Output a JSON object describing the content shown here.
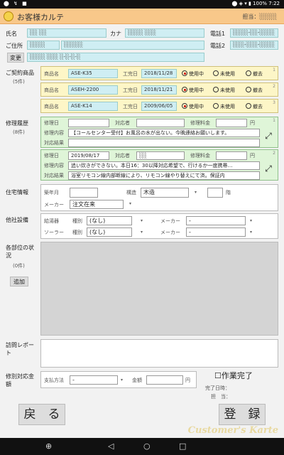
{
  "status": {
    "icons": "⬤ ↯ ■",
    "right": "⬤ ◈ ▾ ▮ 100% 7:22"
  },
  "header": {
    "title": "お客様カルテ",
    "staff": "担当：░░░░"
  },
  "customer": {
    "name_label": "氏名",
    "name_value": "░░ ░░",
    "kana_label": "カナ",
    "kana_value": "░░░░ ░░░",
    "tel1_label": "電話1",
    "tel1_value": "░░░░-░░-░░░░",
    "address_label": "ご住所",
    "address_value": "░░░░",
    "address_value2": "░░░░░",
    "tel2_label": "電話2",
    "tel2_value": "░░░-░░░-░░░░",
    "change_button": "変更",
    "address_line2": "░░░░ ░░░ ░-░-░-░"
  },
  "contracts": {
    "label": "ご契約商品",
    "count": "(5件)",
    "item_label": "商品名",
    "date_label": "工完日",
    "radio_labels": [
      "使用中",
      "未使用",
      "撤去"
    ],
    "items": [
      {
        "name": "ASE-K35",
        "date": "2018/11/28",
        "num": "1"
      },
      {
        "name": "ASEH-2200",
        "date": "2018/11/21",
        "num": "2"
      },
      {
        "name": "ASE-K14",
        "date": "2009/06/05",
        "num": "3"
      }
    ]
  },
  "repairs": {
    "label": "修理履歴",
    "count": "(8件)",
    "date_label": "修理日",
    "staff_label": "対応者",
    "fee_label": "修理料金",
    "yen": "円",
    "content_label": "修理内容",
    "result_label": "対応結果",
    "items": [
      {
        "date": "",
        "staff": "",
        "fee": "",
        "content": "【コールセンター受付】お風呂の水が出ない。今晩連絡お願いします。",
        "result": "",
        "num": "1"
      },
      {
        "date": "2019/08/17",
        "staff": "░░",
        "fee": "",
        "content": "追い炊きができない。本日16：30以降対応希望で、行けるか一度携帯…",
        "result": "浴室リモコン線内部断線により、リモコン線やり替えにて済。保証内",
        "num": "2"
      }
    ]
  },
  "housing": {
    "label": "住宅情報",
    "year_label": "築年月",
    "year_value": "",
    "structure_label": "構造",
    "structure_value": "木造",
    "floor_value": "",
    "floor_unit": "階",
    "maker_label": "メーカー",
    "maker_value": "注文在来"
  },
  "other_equipment": {
    "label": "他社設備",
    "rows": [
      {
        "name": "給湯器",
        "type_label": "種別",
        "type_value": "(なし)",
        "maker_label": "メーカー",
        "maker_value": "-"
      },
      {
        "name": "ソーラー",
        "type_label": "種別",
        "type_value": "(なし)",
        "maker_label": "メーカー",
        "maker_value": "-"
      }
    ]
  },
  "parts": {
    "label": "各部位の状況",
    "count": "(0件)",
    "add_button": "追加"
  },
  "visit": {
    "label": "訪問レポート"
  },
  "special_repair": {
    "label": "修別対応金額",
    "pay_label": "支払方法",
    "pay_value": "-",
    "amount_label": "金額",
    "amount_value": "",
    "yen": "円",
    "done_label": "作業完了",
    "done_time_label": "完了日時：",
    "done_staff_label": "担　当："
  },
  "footer": {
    "back_button": "戻　る",
    "register_button": "登　録",
    "brand": "Customer's Karte"
  },
  "navbar": {
    "zoom": "⊕",
    "back": "◁",
    "home": "○",
    "recent": "□"
  }
}
